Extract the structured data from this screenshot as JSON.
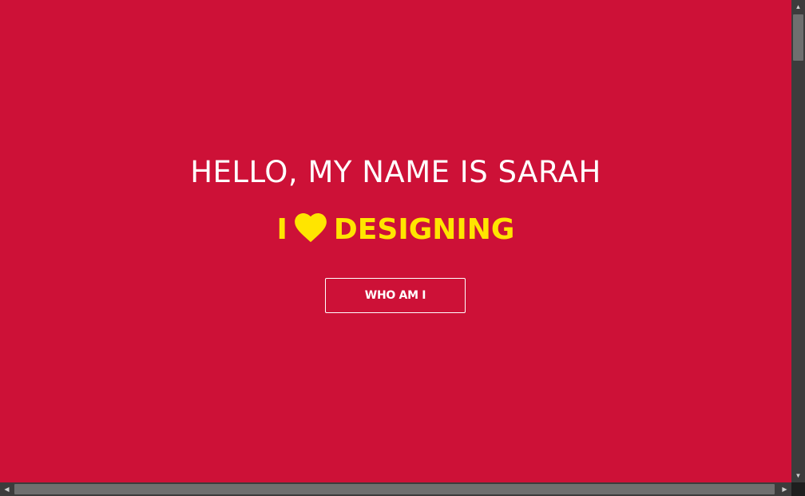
{
  "hero": {
    "headline": "HELLO, MY NAME IS SARAH",
    "tagline_prefix": "I",
    "tagline_icon": "heart-icon",
    "tagline_suffix": "DESIGNING",
    "cta_label": "WHO AM I"
  },
  "colors": {
    "background": "#cd1137",
    "headline": "#ffffff",
    "tagline": "#ffe500",
    "button_border": "#ffffff"
  },
  "scrollbars": {
    "vertical": {
      "up_arrow": "▲",
      "down_arrow": "▼"
    },
    "horizontal": {
      "left_arrow": "◀",
      "right_arrow": "▶"
    }
  }
}
